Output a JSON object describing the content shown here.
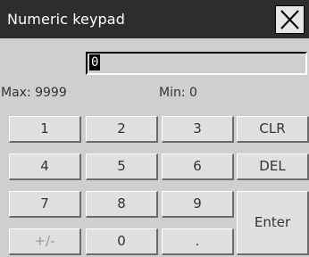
{
  "window": {
    "title": "Numeric keypad",
    "close_icon": "close-icon"
  },
  "display": {
    "value": "0"
  },
  "range": {
    "max": "Max: 9999",
    "min": "Min: 0"
  },
  "keys": {
    "k1": "1",
    "k2": "2",
    "k3": "3",
    "clr": "CLR",
    "k4": "4",
    "k5": "5",
    "k6": "6",
    "del": "DEL",
    "k7": "7",
    "k8": "8",
    "k9": "9",
    "enter": "Enter",
    "sign": "+/-",
    "k0": "0",
    "dot": "."
  }
}
